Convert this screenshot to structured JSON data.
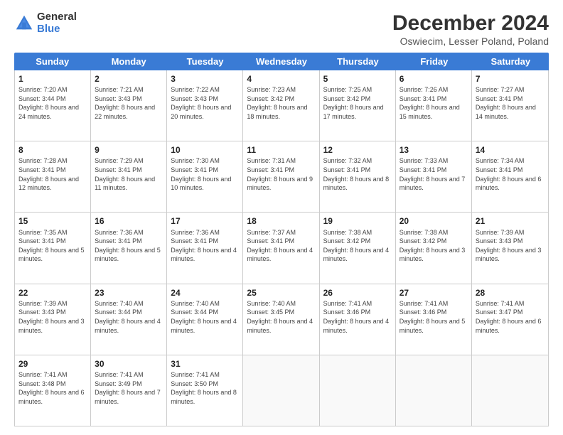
{
  "logo": {
    "general": "General",
    "blue": "Blue"
  },
  "title": "December 2024",
  "location": "Oswiecim, Lesser Poland, Poland",
  "days": [
    "Sunday",
    "Monday",
    "Tuesday",
    "Wednesday",
    "Thursday",
    "Friday",
    "Saturday"
  ],
  "weeks": [
    [
      {
        "day": "1",
        "sunrise": "Sunrise: 7:20 AM",
        "sunset": "Sunset: 3:44 PM",
        "daylight": "Daylight: 8 hours and 24 minutes."
      },
      {
        "day": "2",
        "sunrise": "Sunrise: 7:21 AM",
        "sunset": "Sunset: 3:43 PM",
        "daylight": "Daylight: 8 hours and 22 minutes."
      },
      {
        "day": "3",
        "sunrise": "Sunrise: 7:22 AM",
        "sunset": "Sunset: 3:43 PM",
        "daylight": "Daylight: 8 hours and 20 minutes."
      },
      {
        "day": "4",
        "sunrise": "Sunrise: 7:23 AM",
        "sunset": "Sunset: 3:42 PM",
        "daylight": "Daylight: 8 hours and 18 minutes."
      },
      {
        "day": "5",
        "sunrise": "Sunrise: 7:25 AM",
        "sunset": "Sunset: 3:42 PM",
        "daylight": "Daylight: 8 hours and 17 minutes."
      },
      {
        "day": "6",
        "sunrise": "Sunrise: 7:26 AM",
        "sunset": "Sunset: 3:41 PM",
        "daylight": "Daylight: 8 hours and 15 minutes."
      },
      {
        "day": "7",
        "sunrise": "Sunrise: 7:27 AM",
        "sunset": "Sunset: 3:41 PM",
        "daylight": "Daylight: 8 hours and 14 minutes."
      }
    ],
    [
      {
        "day": "8",
        "sunrise": "Sunrise: 7:28 AM",
        "sunset": "Sunset: 3:41 PM",
        "daylight": "Daylight: 8 hours and 12 minutes."
      },
      {
        "day": "9",
        "sunrise": "Sunrise: 7:29 AM",
        "sunset": "Sunset: 3:41 PM",
        "daylight": "Daylight: 8 hours and 11 minutes."
      },
      {
        "day": "10",
        "sunrise": "Sunrise: 7:30 AM",
        "sunset": "Sunset: 3:41 PM",
        "daylight": "Daylight: 8 hours and 10 minutes."
      },
      {
        "day": "11",
        "sunrise": "Sunrise: 7:31 AM",
        "sunset": "Sunset: 3:41 PM",
        "daylight": "Daylight: 8 hours and 9 minutes."
      },
      {
        "day": "12",
        "sunrise": "Sunrise: 7:32 AM",
        "sunset": "Sunset: 3:41 PM",
        "daylight": "Daylight: 8 hours and 8 minutes."
      },
      {
        "day": "13",
        "sunrise": "Sunrise: 7:33 AM",
        "sunset": "Sunset: 3:41 PM",
        "daylight": "Daylight: 8 hours and 7 minutes."
      },
      {
        "day": "14",
        "sunrise": "Sunrise: 7:34 AM",
        "sunset": "Sunset: 3:41 PM",
        "daylight": "Daylight: 8 hours and 6 minutes."
      }
    ],
    [
      {
        "day": "15",
        "sunrise": "Sunrise: 7:35 AM",
        "sunset": "Sunset: 3:41 PM",
        "daylight": "Daylight: 8 hours and 5 minutes."
      },
      {
        "day": "16",
        "sunrise": "Sunrise: 7:36 AM",
        "sunset": "Sunset: 3:41 PM",
        "daylight": "Daylight: 8 hours and 5 minutes."
      },
      {
        "day": "17",
        "sunrise": "Sunrise: 7:36 AM",
        "sunset": "Sunset: 3:41 PM",
        "daylight": "Daylight: 8 hours and 4 minutes."
      },
      {
        "day": "18",
        "sunrise": "Sunrise: 7:37 AM",
        "sunset": "Sunset: 3:41 PM",
        "daylight": "Daylight: 8 hours and 4 minutes."
      },
      {
        "day": "19",
        "sunrise": "Sunrise: 7:38 AM",
        "sunset": "Sunset: 3:42 PM",
        "daylight": "Daylight: 8 hours and 4 minutes."
      },
      {
        "day": "20",
        "sunrise": "Sunrise: 7:38 AM",
        "sunset": "Sunset: 3:42 PM",
        "daylight": "Daylight: 8 hours and 3 minutes."
      },
      {
        "day": "21",
        "sunrise": "Sunrise: 7:39 AM",
        "sunset": "Sunset: 3:43 PM",
        "daylight": "Daylight: 8 hours and 3 minutes."
      }
    ],
    [
      {
        "day": "22",
        "sunrise": "Sunrise: 7:39 AM",
        "sunset": "Sunset: 3:43 PM",
        "daylight": "Daylight: 8 hours and 3 minutes."
      },
      {
        "day": "23",
        "sunrise": "Sunrise: 7:40 AM",
        "sunset": "Sunset: 3:44 PM",
        "daylight": "Daylight: 8 hours and 4 minutes."
      },
      {
        "day": "24",
        "sunrise": "Sunrise: 7:40 AM",
        "sunset": "Sunset: 3:44 PM",
        "daylight": "Daylight: 8 hours and 4 minutes."
      },
      {
        "day": "25",
        "sunrise": "Sunrise: 7:40 AM",
        "sunset": "Sunset: 3:45 PM",
        "daylight": "Daylight: 8 hours and 4 minutes."
      },
      {
        "day": "26",
        "sunrise": "Sunrise: 7:41 AM",
        "sunset": "Sunset: 3:46 PM",
        "daylight": "Daylight: 8 hours and 4 minutes."
      },
      {
        "day": "27",
        "sunrise": "Sunrise: 7:41 AM",
        "sunset": "Sunset: 3:46 PM",
        "daylight": "Daylight: 8 hours and 5 minutes."
      },
      {
        "day": "28",
        "sunrise": "Sunrise: 7:41 AM",
        "sunset": "Sunset: 3:47 PM",
        "daylight": "Daylight: 8 hours and 6 minutes."
      }
    ],
    [
      {
        "day": "29",
        "sunrise": "Sunrise: 7:41 AM",
        "sunset": "Sunset: 3:48 PM",
        "daylight": "Daylight: 8 hours and 6 minutes."
      },
      {
        "day": "30",
        "sunrise": "Sunrise: 7:41 AM",
        "sunset": "Sunset: 3:49 PM",
        "daylight": "Daylight: 8 hours and 7 minutes."
      },
      {
        "day": "31",
        "sunrise": "Sunrise: 7:41 AM",
        "sunset": "Sunset: 3:50 PM",
        "daylight": "Daylight: 8 hours and 8 minutes."
      },
      null,
      null,
      null,
      null
    ]
  ]
}
